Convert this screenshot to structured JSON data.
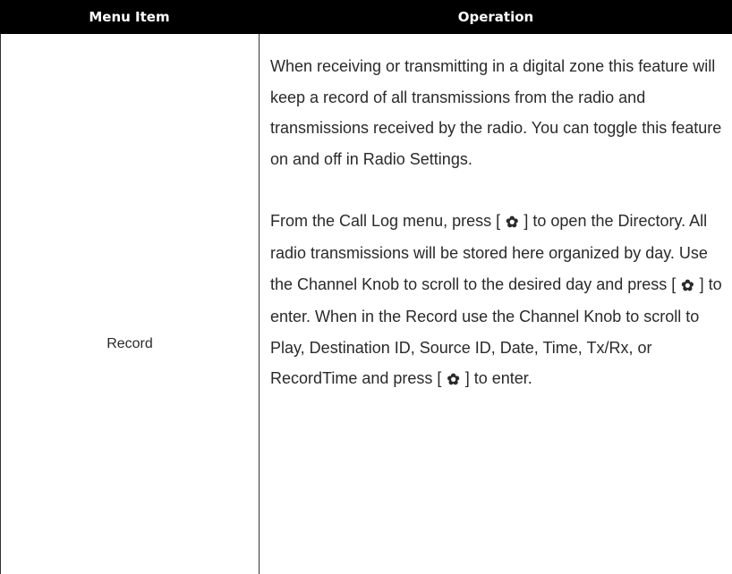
{
  "table": {
    "headers": {
      "menu_item": "Menu Item",
      "operation": "Operation"
    },
    "row": {
      "menu_item": "Record",
      "paragraph_1": "When receiving or transmitting in a digital zone this feature will keep a record of all transmissions from the radio and transmissions received by the radio. You can toggle this feature on and off in Radio Settings.",
      "p2": {
        "a": "From the Call Log menu, press  [",
        "b": "] to open the Directory. All radio transmissions will be stored here organized by day. Use the Channel Knob to scroll to the desired day and press [",
        "c": "] to enter. When in the Record use the Channel Knob to scroll to Play, Destination ID, Source ID, Date, Time, Tx/Rx, or RecordTime and press [",
        "d": "] to enter."
      },
      "icon": "gear-icon",
      "icon_glyph": "✿"
    }
  }
}
